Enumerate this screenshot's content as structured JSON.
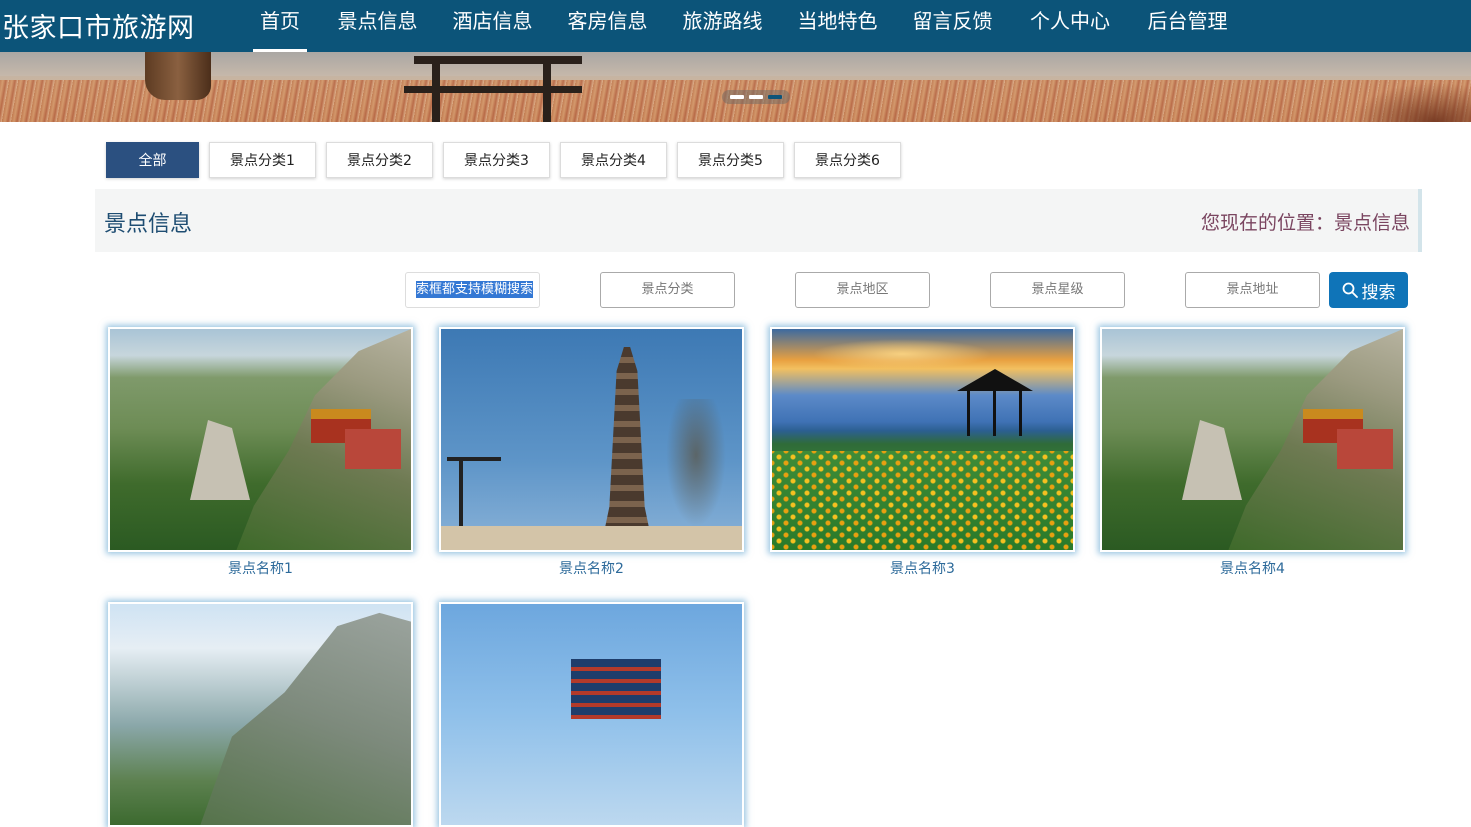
{
  "header": {
    "site_title": "张家口市旅游网",
    "nav": [
      {
        "label": "首页",
        "active": true
      },
      {
        "label": "景点信息",
        "active": false
      },
      {
        "label": "酒店信息",
        "active": false
      },
      {
        "label": "客房信息",
        "active": false
      },
      {
        "label": "旅游路线",
        "active": false
      },
      {
        "label": "当地特色",
        "active": false
      },
      {
        "label": "留言反馈",
        "active": false
      },
      {
        "label": "个人中心",
        "active": false
      },
      {
        "label": "后台管理",
        "active": false
      }
    ]
  },
  "banner": {
    "slides": 3,
    "active_slide": 3
  },
  "categories": [
    {
      "label": "全部",
      "active": true
    },
    {
      "label": "景点分类1",
      "active": false
    },
    {
      "label": "景点分类2",
      "active": false
    },
    {
      "label": "景点分类3",
      "active": false
    },
    {
      "label": "景点分类4",
      "active": false
    },
    {
      "label": "景点分类5",
      "active": false
    },
    {
      "label": "景点分类6",
      "active": false
    }
  ],
  "section": {
    "title": "景点信息",
    "location": "您现在的位置：景点信息"
  },
  "search": {
    "keyword_value": "索框都支持模糊搜索",
    "category_placeholder": "景点分类",
    "region_placeholder": "景点地区",
    "star_placeholder": "景点星级",
    "address_placeholder": "景点地址",
    "button_label": "搜索"
  },
  "spots": [
    {
      "name": "景点名称1",
      "image": "mountain-temple"
    },
    {
      "name": "景点名称2",
      "image": "pagoda"
    },
    {
      "name": "景点名称3",
      "image": "grassland-pavilion"
    },
    {
      "name": "景点名称4",
      "image": "mountain-temple"
    },
    {
      "name": "",
      "image": "cliff"
    },
    {
      "name": "",
      "image": "tower"
    }
  ],
  "colors": {
    "header_bg": "#0c5479",
    "tab_active_bg": "#2b5080",
    "search_button_bg": "#0f74b8",
    "link_text": "#2d6a9a"
  }
}
